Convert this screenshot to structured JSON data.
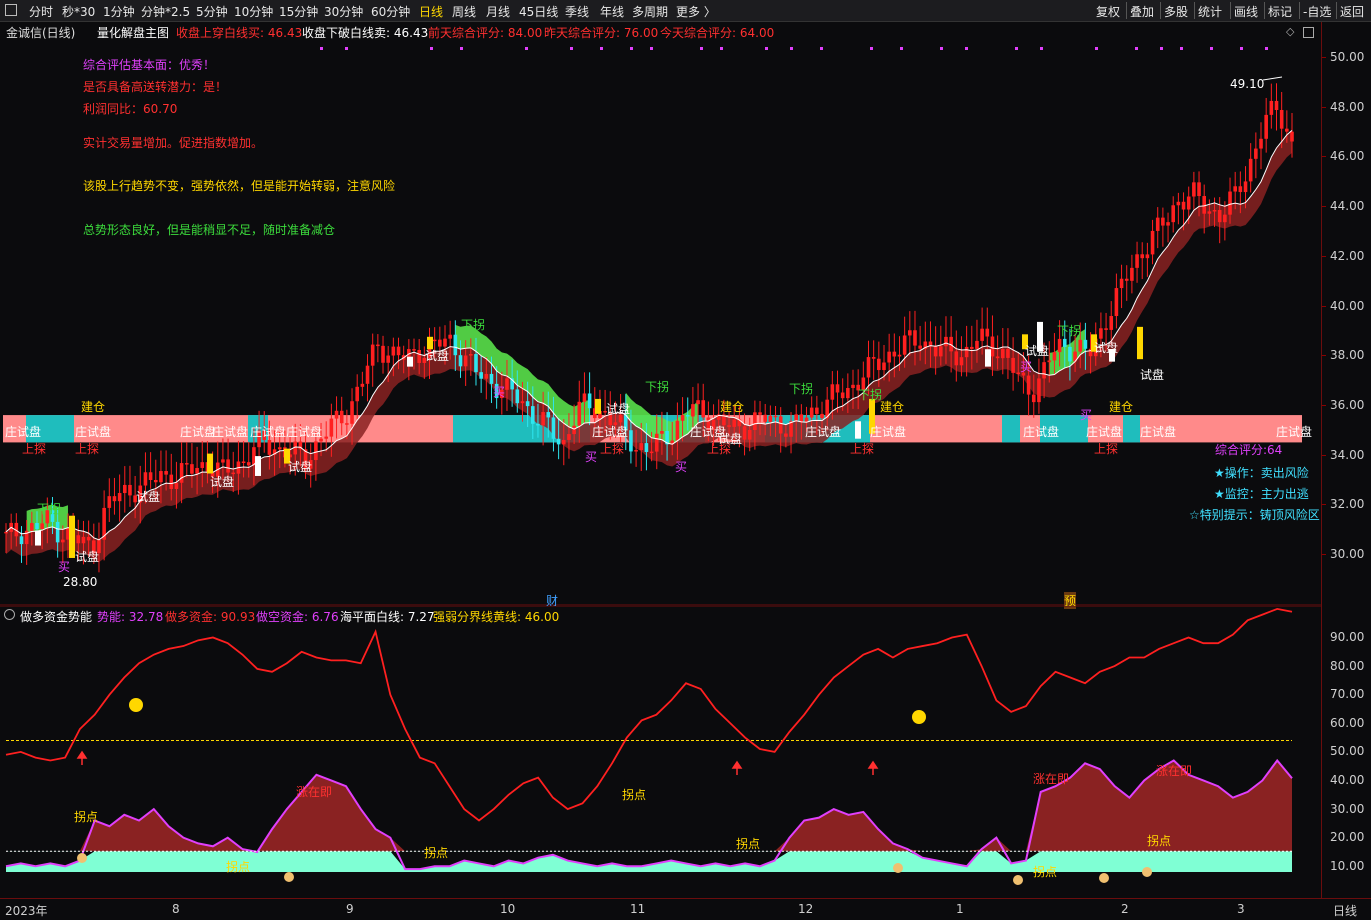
{
  "toolbar": {
    "periods": [
      "分时",
      "秒*30",
      "1分钟",
      "分钟*2.5",
      "5分钟",
      "10分钟",
      "15分钟",
      "30分钟",
      "60分钟",
      "日线",
      "周线",
      "月线",
      "45日线",
      "季线",
      "年线",
      "多周期",
      "更多 〉"
    ],
    "active": "日线",
    "right": [
      "复权",
      "叠加",
      "多股",
      "统计",
      "画线",
      "标记",
      "-自选",
      "返回"
    ]
  },
  "main_header": {
    "title": "金诚信(日线)",
    "indicator": "量化解盘主图",
    "items": [
      {
        "text": "收盘上穿白线买: 46.43",
        "color": "#ff3030"
      },
      {
        "text": "收盘下破白线卖: 46.43",
        "color": "#ffffff"
      },
      {
        "text": "前天综合评分: 84.00",
        "color": "#ff3030"
      },
      {
        "text": "昨天综合评分: 76.00",
        "color": "#ff3030"
      },
      {
        "text": "今天综合评分: 64.00",
        "color": "#ff3030"
      }
    ]
  },
  "notes": [
    {
      "text": "综合评估基本面：优秀！",
      "color": "#e040fb"
    },
    {
      "text": "是否具备高送转潜力：是！",
      "color": "#ff3030"
    },
    {
      "text": "利润同比：60.70",
      "color": "#ff3030"
    },
    {
      "text": "实计交易量增加。促进指数增加。",
      "color": "#ff3030"
    },
    {
      "text": "该股上行趋势不变，强势依然，但是能开始转弱，注意风险",
      "color": "#ffd700"
    },
    {
      "text": "总势形态良好，但是能稍显不足，随时准备减仓",
      "color": "#3cdc3c"
    }
  ],
  "side_notes": [
    {
      "text": "综合评分:64",
      "color": "#e040fb"
    },
    {
      "text": "★操作：卖出风险",
      "color": "#40e0ff"
    },
    {
      "text": "★监控：主力出逃",
      "color": "#40e0ff"
    },
    {
      "text": "☆特别提示：铸顶风险区",
      "color": "#40e0ff"
    }
  ],
  "price_marks": {
    "high": "49.10",
    "low": "28.80"
  },
  "event_marks": {
    "fin": "财",
    "pre": "预"
  },
  "sub_header": {
    "name": "做多资金势能",
    "items": [
      {
        "text": "势能: 32.78",
        "color": "#e040fb"
      },
      {
        "text": "做多资金: 90.93",
        "color": "#ff3030"
      },
      {
        "text": "做空资金: 6.76",
        "color": "#e040fb"
      },
      {
        "text": "海平面白线: 7.27",
        "color": "#ffffff"
      },
      {
        "text": "强弱分界线黄线: 46.00",
        "color": "#ffd700"
      }
    ]
  },
  "sub_labels": {
    "guaidian": "拐点",
    "zhangzaiji": "涨在即"
  },
  "main_labels": {
    "shipan": "试盘",
    "zhuangshipan": "庄试盘",
    "xiaguai": "下拐",
    "jiancang": "建仓",
    "shangtan": "上探",
    "mai": "买"
  },
  "y_main": [
    "50.00",
    "48.00",
    "46.00",
    "44.00",
    "42.00",
    "40.00",
    "38.00",
    "36.00",
    "34.00",
    "32.00",
    "30.00"
  ],
  "y_sub": [
    "90.00",
    "80.00",
    "70.00",
    "60.00",
    "50.00",
    "40.00",
    "30.00",
    "20.00",
    "10.00"
  ],
  "x_labels": [
    "2023年",
    "8",
    "9",
    "10",
    "11",
    "12",
    "1",
    "2",
    "3"
  ],
  "x_right": "日线",
  "colors": {
    "up": "#ff2020",
    "down": "#2ee6f0",
    "band_pink": "#ff8a8a",
    "band_teal": "#1fbdbd",
    "ribbon": "#8a2222",
    "long_fund": "#ff2020",
    "potential": "#e040fb",
    "sea": "#7fffd4",
    "yellow": "#ffd700"
  },
  "chart_data": [
    {
      "type": "candlestick",
      "title": "量化解盘主图",
      "ylim": [
        28.0,
        50.5
      ],
      "close_series": [
        30.6,
        30.9,
        31.0,
        31.3,
        30.8,
        30.5,
        30.2,
        31.8,
        32.4,
        32.6,
        32.8,
        33.2,
        33.0,
        33.4,
        33.6,
        33.2,
        33.5,
        33.9,
        34.5,
        34.2,
        34.0,
        33.8,
        34.6,
        35.2,
        35.8,
        37.0,
        38.4,
        38.0,
        37.8,
        38.2,
        38.3,
        38.6,
        37.9,
        37.2,
        36.9,
        36.5,
        36.2,
        35.5,
        35.0,
        34.4,
        35.8,
        35.9,
        35.6,
        35.0,
        34.4,
        34.1,
        34.6,
        35.2,
        35.8,
        35.6,
        35.2,
        35.0,
        35.2,
        35.4,
        35.3,
        35.0,
        35.5,
        35.9,
        36.3,
        36.6,
        37.2,
        37.6,
        38.1,
        38.4,
        38.6,
        38.2,
        38.1,
        38.0,
        38.6,
        38.4,
        37.9,
        36.8,
        36.6,
        37.8,
        38.4,
        38.2,
        38.0,
        39.5,
        40.6,
        41.7,
        42.6,
        43.2,
        44.2,
        44.4,
        43.9,
        43.6,
        44.3,
        45.6,
        47.2,
        48.0,
        46.43
      ]
    },
    {
      "type": "line",
      "title": "做多资金势能",
      "ylim": [
        0,
        95
      ],
      "series": [
        {
          "name": "做多资金",
          "values": [
            41,
            42,
            40,
            39,
            40,
            50,
            55,
            62,
            68,
            73,
            76,
            78,
            79,
            81,
            82,
            80,
            76,
            71,
            70,
            73,
            77,
            75,
            74,
            74,
            73,
            84,
            62,
            50,
            40,
            38,
            30,
            22,
            18,
            22,
            27,
            31,
            33,
            26,
            22,
            24,
            30,
            38,
            47,
            53,
            55,
            60,
            66,
            64,
            57,
            52,
            47,
            43,
            42,
            49,
            55,
            62,
            68,
            72,
            76,
            78,
            75,
            78,
            79,
            80,
            82,
            83,
            72,
            60,
            56,
            58,
            65,
            70,
            68,
            66,
            70,
            72,
            75,
            75,
            78,
            80,
            82,
            80,
            80,
            83,
            88,
            90,
            92,
            91
          ]
        },
        {
          "name": "势能",
          "values": [
            2,
            3,
            2,
            3,
            2,
            4,
            18,
            16,
            20,
            18,
            22,
            16,
            12,
            10,
            9,
            12,
            8,
            7,
            15,
            22,
            28,
            34,
            32,
            30,
            22,
            15,
            12,
            1,
            1,
            2,
            2,
            4,
            3,
            2,
            4,
            3,
            5,
            6,
            4,
            3,
            2,
            3,
            2,
            2,
            3,
            4,
            3,
            2,
            3,
            2,
            3,
            2,
            4,
            12,
            18,
            19,
            22,
            20,
            21,
            15,
            10,
            8,
            5,
            4,
            3,
            2,
            8,
            12,
            3,
            4,
            28,
            30,
            33,
            38,
            36,
            30,
            26,
            32,
            36,
            39,
            34,
            32,
            30,
            26,
            28,
            32,
            39,
            32.78
          ]
        }
      ],
      "hlines": {
        "海平面白线": 7.27,
        "强弱分界线黄线": 46.0
      }
    }
  ]
}
